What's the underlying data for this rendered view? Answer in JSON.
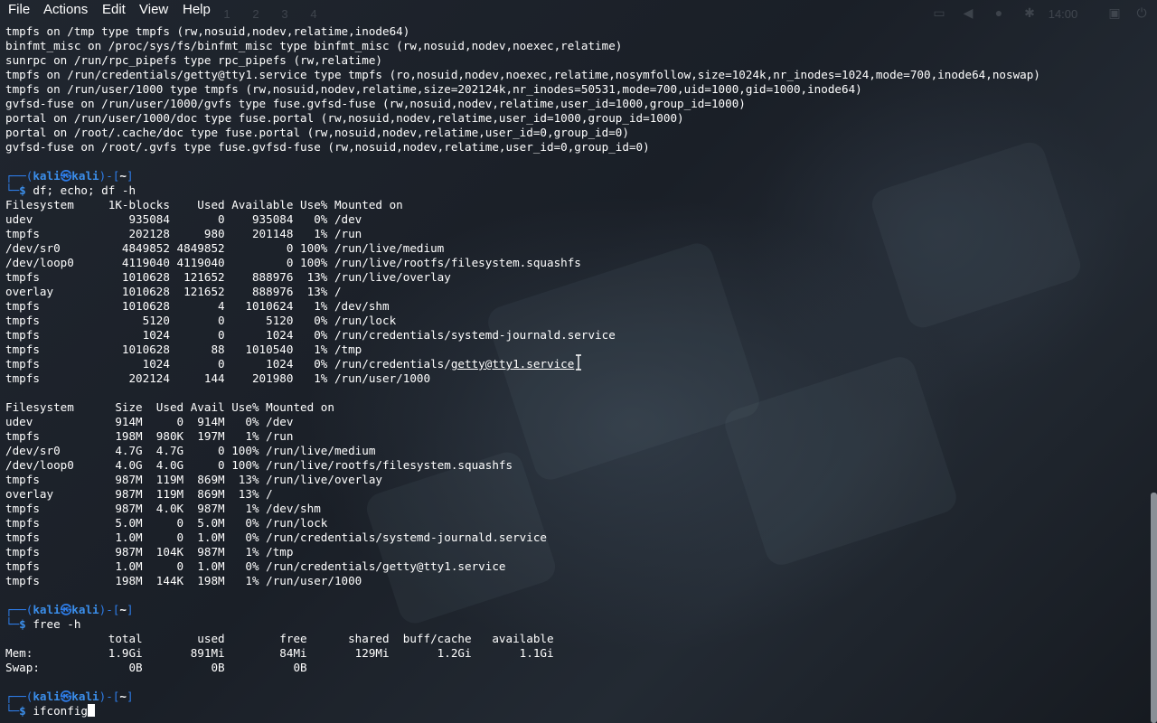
{
  "menu": {
    "file": "File",
    "actions": "Actions",
    "edit": "Edit",
    "view": "View",
    "help": "Help"
  },
  "panel": {
    "workspaces": [
      "1",
      "2",
      "3",
      "4"
    ],
    "clock": "14:00"
  },
  "prompt": {
    "user": "kali",
    "host": "kali",
    "dir": "~"
  },
  "mount_lines": [
    "tmpfs on /tmp type tmpfs (rw,nosuid,nodev,relatime,inode64)",
    "binfmt_misc on /proc/sys/fs/binfmt_misc type binfmt_misc (rw,nosuid,nodev,noexec,relatime)",
    "sunrpc on /run/rpc_pipefs type rpc_pipefs (rw,relatime)",
    "tmpfs on /run/credentials/getty@tty1.service type tmpfs (ro,nosuid,nodev,noexec,relatime,nosymfollow,size=1024k,nr_inodes=1024,mode=700,inode64,noswap)",
    "tmpfs on /run/user/1000 type tmpfs (rw,nosuid,nodev,relatime,size=202124k,nr_inodes=50531,mode=700,uid=1000,gid=1000,inode64)",
    "gvfsd-fuse on /run/user/1000/gvfs type fuse.gvfsd-fuse (rw,nosuid,nodev,relatime,user_id=1000,group_id=1000)",
    "portal on /run/user/1000/doc type fuse.portal (rw,nosuid,nodev,relatime,user_id=1000,group_id=1000)",
    "portal on /root/.cache/doc type fuse.portal (rw,nosuid,nodev,relatime,user_id=0,group_id=0)",
    "gvfsd-fuse on /root/.gvfs type fuse.gvfsd-fuse (rw,nosuid,nodev,relatime,user_id=0,group_id=0)"
  ],
  "commands": {
    "df": "df; echo; df -h",
    "free": "free -h",
    "ifconfig": "ifconfig"
  },
  "df_lines": [
    "Filesystem     1K-blocks    Used Available Use% Mounted on",
    "udev              935084       0    935084   0% /dev",
    "tmpfs             202128     980    201148   1% /run",
    "/dev/sr0         4849852 4849852         0 100% /run/live/medium",
    "/dev/loop0       4119040 4119040         0 100% /run/live/rootfs/filesystem.squashfs",
    "tmpfs            1010628  121652    888976  13% /run/live/overlay",
    "overlay          1010628  121652    888976  13% /",
    "tmpfs            1010628       4   1010624   1% /dev/shm",
    "tmpfs               5120       0      5120   0% /run/lock",
    "tmpfs               1024       0      1024   0% /run/credentials/systemd-journald.service",
    "tmpfs            1010628      88   1010540   1% /tmp"
  ],
  "df_link_row": {
    "prefix": "tmpfs               1024       0      1024   0% /run/credentials/",
    "link": "getty@tty1.service"
  },
  "df_last_line": "tmpfs             202124     144    201980   1% /run/user/1000",
  "dfh_lines": [
    "Filesystem      Size  Used Avail Use% Mounted on",
    "udev            914M     0  914M   0% /dev",
    "tmpfs           198M  980K  197M   1% /run",
    "/dev/sr0        4.7G  4.7G     0 100% /run/live/medium",
    "/dev/loop0      4.0G  4.0G     0 100% /run/live/rootfs/filesystem.squashfs",
    "tmpfs           987M  119M  869M  13% /run/live/overlay",
    "overlay         987M  119M  869M  13% /",
    "tmpfs           987M  4.0K  987M   1% /dev/shm",
    "tmpfs           5.0M     0  5.0M   0% /run/lock",
    "tmpfs           1.0M     0  1.0M   0% /run/credentials/systemd-journald.service",
    "tmpfs           987M  104K  987M   1% /tmp",
    "tmpfs           1.0M     0  1.0M   0% /run/credentials/getty@tty1.service",
    "tmpfs           198M  144K  198M   1% /run/user/1000"
  ],
  "free_lines": [
    "               total        used        free      shared  buff/cache   available",
    "Mem:           1.9Gi       891Mi        84Mi       129Mi       1.2Gi       1.1Gi",
    "Swap:             0B          0B          0B"
  ],
  "colors": {
    "prompt_frame": "#2e7de9",
    "prompt_user": "#3b8eea",
    "text": "#ffffff",
    "background": "#1b2029"
  }
}
